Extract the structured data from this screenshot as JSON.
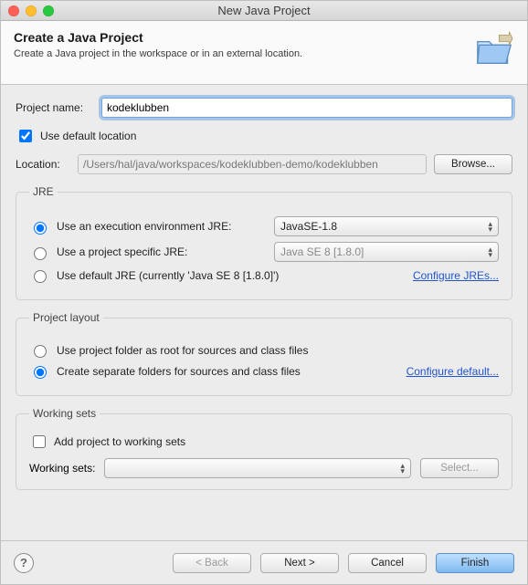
{
  "window": {
    "title": "New Java Project"
  },
  "header": {
    "title": "Create a Java Project",
    "subtitle": "Create a Java project in the workspace or in an external location."
  },
  "project": {
    "name_label": "Project name:",
    "name_value": "kodeklubben",
    "use_default_location_label": "Use default location",
    "use_default_location_checked": true,
    "location_label": "Location:",
    "location_value": "/Users/hal/java/workspaces/kodeklubben-demo/kodeklubben",
    "browse_label": "Browse..."
  },
  "jre": {
    "legend": "JRE",
    "opt_env_label": "Use an execution environment JRE:",
    "env_value": "JavaSE-1.8",
    "opt_specific_label": "Use a project specific JRE:",
    "specific_value": "Java SE 8 [1.8.0]",
    "opt_default_label": "Use default JRE (currently 'Java SE 8 [1.8.0]')",
    "configure_link": "Configure JREs...",
    "selected": "env"
  },
  "layout": {
    "legend": "Project layout",
    "opt_root_label": "Use project folder as root for sources and class files",
    "opt_separate_label": "Create separate folders for sources and class files",
    "configure_link": "Configure default...",
    "selected": "separate"
  },
  "working_sets": {
    "legend": "Working sets",
    "add_label": "Add project to working sets",
    "add_checked": false,
    "label": "Working sets:",
    "select_btn": "Select..."
  },
  "footer": {
    "back": "< Back",
    "next": "Next >",
    "cancel": "Cancel",
    "finish": "Finish"
  }
}
